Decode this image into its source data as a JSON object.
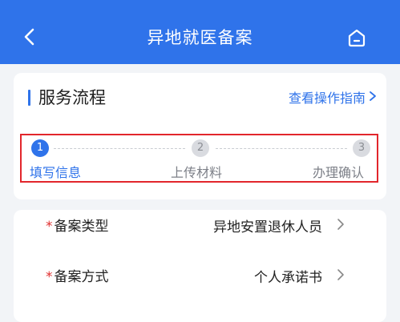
{
  "header": {
    "title": "异地就医备案",
    "back_icon": "chevron-left-icon",
    "home_icon": "home-icon",
    "background_color": "#2f73ea"
  },
  "service_flow": {
    "title": "服务流程",
    "guide_link": "查看操作指南",
    "guide_chevron": "›",
    "steps": [
      {
        "number": "1",
        "label": "填写信息",
        "state": "active"
      },
      {
        "number": "2",
        "label": "上传材料",
        "state": "inactive"
      },
      {
        "number": "3",
        "label": "办理确认",
        "state": "inactive"
      }
    ]
  },
  "form": {
    "rows": [
      {
        "required_mark": "*",
        "label": "备案类型",
        "value": "异地安置退休人员"
      },
      {
        "required_mark": "*",
        "label": "备案方式",
        "value": "个人承诺书"
      }
    ]
  },
  "colors": {
    "accent": "#2f73ea",
    "required": "#e02f2f",
    "highlight_border": "#e2262c"
  }
}
